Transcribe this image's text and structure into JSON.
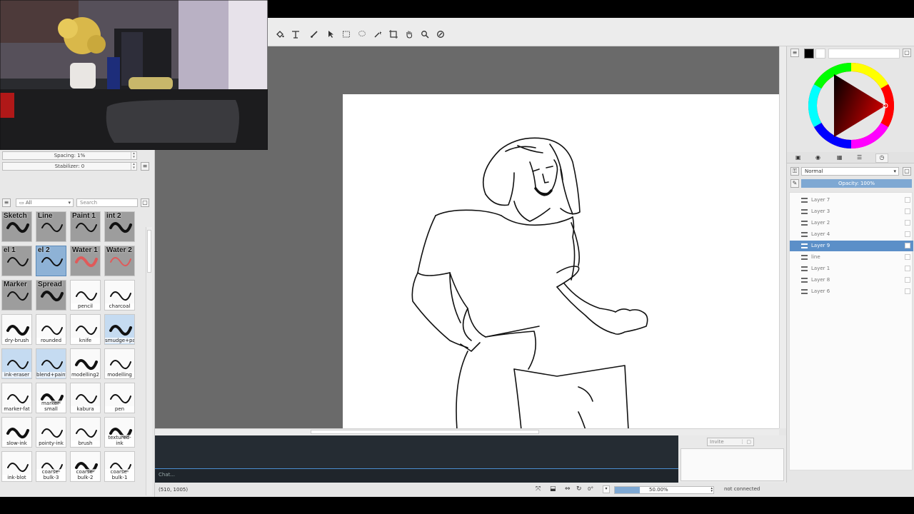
{
  "toolbar": {
    "tools": [
      "fill-icon",
      "transform-icon",
      "brush-icon",
      "select-arrow-icon",
      "rect-select-icon",
      "lasso-icon",
      "magic-wand-icon",
      "crop-icon",
      "hand-icon",
      "zoom-icon",
      "eyedropper-icon"
    ]
  },
  "left_panel": {
    "spacing_label": "Spacing: 1%",
    "stabilizer_label": "Stabilizer: 0",
    "filter_value": "All",
    "search_placeholder": "Search",
    "brushes": [
      {
        "top": "Sketch",
        "bottom": ""
      },
      {
        "top": "Line",
        "bottom": ""
      },
      {
        "top": "Paint 1",
        "bottom": ""
      },
      {
        "top": "int 2",
        "bottom": ""
      },
      {
        "top": "el 1",
        "bottom": ""
      },
      {
        "top": "el 2",
        "bottom": ""
      },
      {
        "top": "Water 1",
        "bottom": ""
      },
      {
        "top": "Water 2",
        "bottom": ""
      },
      {
        "top": "Marker",
        "bottom": ""
      },
      {
        "top": "Spread",
        "bottom": ""
      },
      {
        "top": "",
        "bottom": "pencil"
      },
      {
        "top": "",
        "bottom": "charcoal"
      },
      {
        "top": "",
        "bottom": "dry-brush"
      },
      {
        "top": "",
        "bottom": "rounded"
      },
      {
        "top": "",
        "bottom": "knife"
      },
      {
        "top": "",
        "bottom": "smudge+paint"
      },
      {
        "top": "",
        "bottom": "ink-eraser"
      },
      {
        "top": "",
        "bottom": "blend+paint"
      },
      {
        "top": "",
        "bottom": "modelling2"
      },
      {
        "top": "",
        "bottom": "modelling"
      },
      {
        "top": "",
        "bottom": "marker-fat"
      },
      {
        "top": "",
        "bottom": "marker-small"
      },
      {
        "top": "",
        "bottom": "kabura"
      },
      {
        "top": "",
        "bottom": "pen"
      },
      {
        "top": "",
        "bottom": "slow-ink"
      },
      {
        "top": "",
        "bottom": "pointy-ink"
      },
      {
        "top": "",
        "bottom": "brush"
      },
      {
        "top": "",
        "bottom": "textured-ink"
      },
      {
        "top": "",
        "bottom": "ink-blot"
      },
      {
        "top": "",
        "bottom": "coarse-bulk-3"
      },
      {
        "top": "",
        "bottom": "coarse-bulk-2"
      },
      {
        "top": "",
        "bottom": "coarse-bulk-1"
      }
    ],
    "selected_brush_index": 5
  },
  "status": {
    "coords": "(510, 1005)",
    "rotation": "0°",
    "zoom": "50.00%",
    "zoom_fraction": 0.5,
    "connection": "not connected"
  },
  "chat": {
    "placeholder": "Chat..."
  },
  "invite": {
    "label": "Invite"
  },
  "right_panel": {
    "blend_mode": "Normal",
    "opacity": "Opacity: 100%",
    "layers": [
      {
        "name": "Layer 7",
        "selected": false
      },
      {
        "name": "Layer 3",
        "selected": false
      },
      {
        "name": "Layer 2",
        "selected": false
      },
      {
        "name": "Layer 4",
        "selected": false
      },
      {
        "name": "Layer 9",
        "selected": true
      },
      {
        "name": "line",
        "selected": false
      },
      {
        "name": "Layer 1",
        "selected": false
      },
      {
        "name": "Layer 8",
        "selected": false
      },
      {
        "name": "Layer 6",
        "selected": false
      }
    ],
    "foreground_color": "#000000",
    "background_color": "#ffffff"
  },
  "colors": {
    "selection": "#5b8fc8",
    "accent": "#7ea8d3"
  }
}
